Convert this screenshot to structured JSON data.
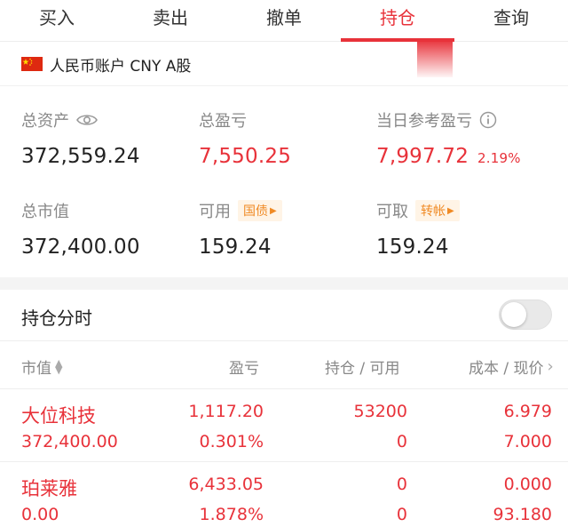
{
  "tabs": [
    {
      "label": "买入"
    },
    {
      "label": "卖出"
    },
    {
      "label": "撤单"
    },
    {
      "label": "持仓"
    },
    {
      "label": "查询"
    }
  ],
  "account": {
    "label": "人民币账户 CNY A股"
  },
  "summary": {
    "total_assets": {
      "label": "总资产",
      "value": "372,559.24"
    },
    "total_pnl": {
      "label": "总盈亏",
      "value": "7,550.25"
    },
    "daily_pnl": {
      "label": "当日参考盈亏",
      "value": "7,997.72",
      "pct": "2.19%"
    },
    "market_value": {
      "label": "总市值",
      "value": "372,400.00"
    },
    "available": {
      "label": "可用",
      "tag": "国债",
      "value": "159.24"
    },
    "withdrawable": {
      "label": "可取",
      "tag": "转帐",
      "value": "159.24"
    }
  },
  "section": {
    "title": "持仓分时"
  },
  "table": {
    "headers": [
      "市值",
      "盈亏",
      "持仓 / 可用",
      "成本 / 现价"
    ],
    "rows": [
      {
        "name": "大位科技",
        "market_value": "372,400.00",
        "pnl": "1,117.20",
        "pnl_pct": "0.301%",
        "position": "53200",
        "available": "0",
        "cost": "6.979",
        "price": "7.000"
      },
      {
        "name": "珀莱雅",
        "market_value": "0.00",
        "pnl": "6,433.05",
        "pnl_pct": "1.878%",
        "position": "0",
        "available": "0",
        "cost": "0.000",
        "price": "93.180"
      }
    ]
  },
  "colors": {
    "accent": "#e8323a",
    "muted": "#888888",
    "tag": "#f08a24"
  }
}
